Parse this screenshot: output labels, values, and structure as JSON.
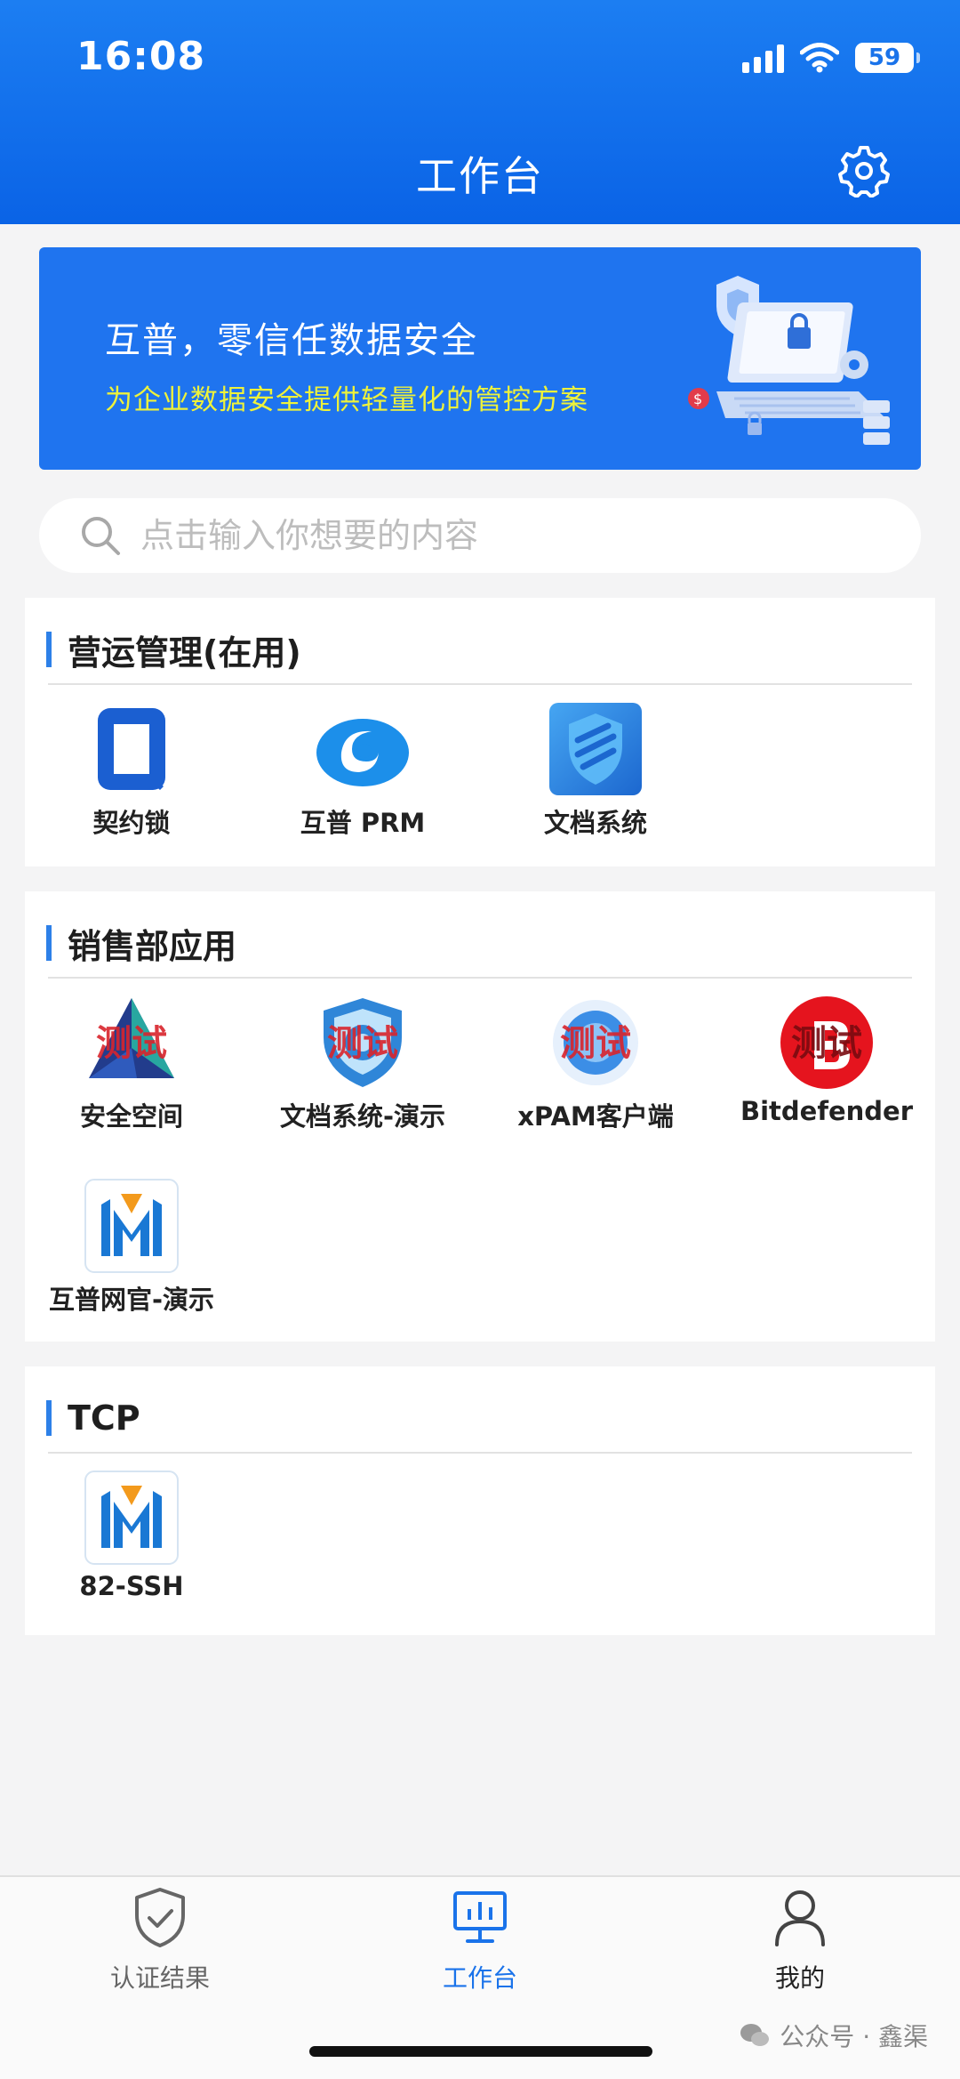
{
  "status_bar": {
    "time": "16:08",
    "battery": "59"
  },
  "header": {
    "title": "工作台"
  },
  "banner": {
    "title": "互普，零信任数据安全",
    "subtitle": "为企业数据安全提供轻量化的管控方案"
  },
  "search": {
    "placeholder": "点击输入你想要的内容"
  },
  "sections": [
    {
      "title": "营运管理(在用)",
      "apps": [
        {
          "label": "契约锁",
          "icon": "contract-lock-icon"
        },
        {
          "label": "互普 PRM",
          "icon": "prm-swirl-icon"
        },
        {
          "label": "文档系统",
          "icon": "document-shield-icon"
        }
      ]
    },
    {
      "title": "销售部应用",
      "apps": [
        {
          "label": "安全空间",
          "icon": "triangle-logo-icon",
          "badge": "测试"
        },
        {
          "label": "文档系统-演示",
          "icon": "shield-logo-icon",
          "badge": "测试"
        },
        {
          "label": "xPAM客户端",
          "icon": "xpam-logo-icon",
          "badge": "测试"
        },
        {
          "label": "Bitdefender",
          "icon": "bitdefender-logo-icon",
          "badge": "测试"
        },
        {
          "label": "互普网官-演示",
          "icon": "m-logo-icon"
        }
      ]
    },
    {
      "title": "TCP",
      "apps": [
        {
          "label": "82-SSH",
          "icon": "m-logo-icon"
        }
      ]
    }
  ],
  "tabbar": {
    "items": [
      {
        "label": "认证结果",
        "icon": "shield-check-icon",
        "active": false
      },
      {
        "label": "工作台",
        "icon": "dashboard-icon",
        "active": true
      },
      {
        "label": "我的",
        "icon": "person-icon",
        "active": false
      }
    ]
  },
  "watermark": {
    "text": "公众号 · 鑫渠"
  },
  "colors": {
    "primary": "#1a73ea",
    "active_tab": "#1a73ea",
    "inactive_tab": "#666666",
    "banner_sub": "#eef23a"
  }
}
